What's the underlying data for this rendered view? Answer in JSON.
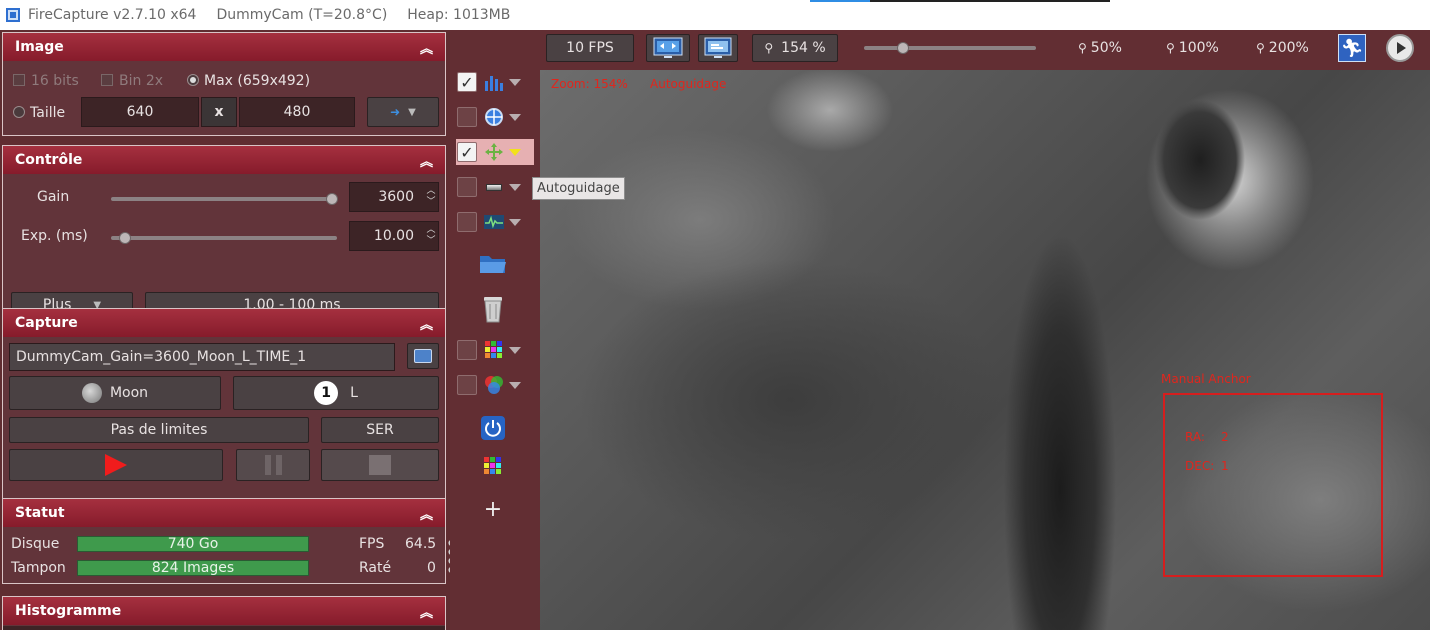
{
  "titlebar": {
    "app": "FireCapture v2.7.10 x64",
    "camera": "DummyCam (T=20.8°C)",
    "heap": "Heap: 1013MB"
  },
  "image_panel": {
    "title": "Image",
    "opt_16bits": "16 bits",
    "opt_bin2x": "Bin 2x",
    "opt_max": "Max (659x492)",
    "opt_taille": "Taille",
    "width": "640",
    "x_label": "x",
    "height": "480"
  },
  "controle_panel": {
    "title": "Contrôle",
    "gain_label": "Gain",
    "gain_value": "3600",
    "gain_fraction": 0.98,
    "exp_label": "Exp. (ms)",
    "exp_value": "10.00",
    "exp_fraction": 0.06,
    "plus_label": "Plus",
    "range_label": "1.00 - 100 ms"
  },
  "capture_panel": {
    "title": "Capture",
    "filename": "DummyCam_Gain=3600_Moon_L_TIME_1",
    "object_label": "Moon",
    "filter_number": "1",
    "filter_label": "L",
    "limits_label": "Pas de limites",
    "format_label": "SER"
  },
  "statut_panel": {
    "title": "Statut",
    "disk_label": "Disque",
    "disk_value": "740 Go",
    "buffer_label": "Tampon",
    "buffer_value": "824 Images",
    "fps_label": "FPS",
    "fps_value": "64.5",
    "missed_label": "Raté",
    "missed_value": "0"
  },
  "histogram_panel": {
    "title": "Histogramme"
  },
  "topbar": {
    "fps_button": "10 FPS",
    "zoom_current": "154 %",
    "zoom_50": "50%",
    "zoom_100": "100%",
    "zoom_200": "200%"
  },
  "viewer": {
    "zoom_info": "Zoom: 154%",
    "mode_info": "Autoguidage",
    "anchor_title": "Manual Anchor",
    "ra_label": "RA:",
    "ra_value": "2",
    "dec_label": "DEC:",
    "dec_value": "1"
  },
  "tooltip": "Autoguidage",
  "colors": {
    "panel_header": "#9c2637",
    "background": "#622e33",
    "accent_red": "#e0261d",
    "progress_green": "#3f9a4c"
  },
  "icons": [
    "histogram-icon",
    "target-icon",
    "autoguide-icon",
    "gray-bar-icon",
    "waveform-icon",
    "folder-icon",
    "trash-icon",
    "color-grid-icon",
    "rgb-circles-icon",
    "power-icon",
    "plus-icon"
  ]
}
